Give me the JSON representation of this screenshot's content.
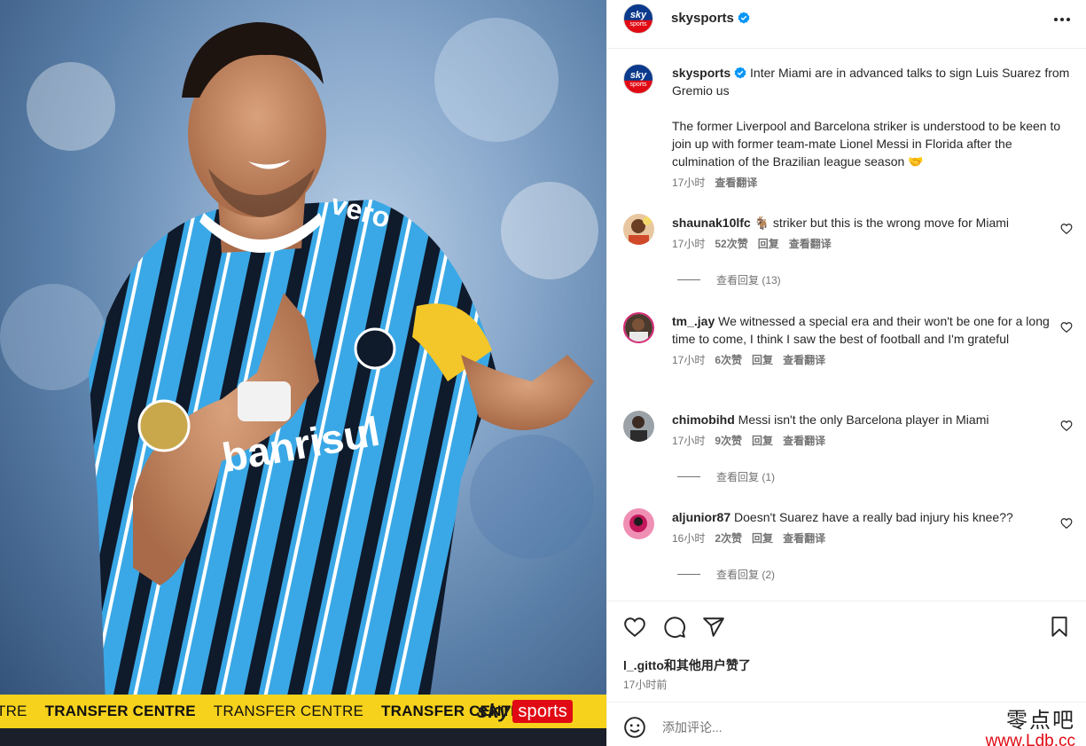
{
  "media": {
    "ticker": [
      "TRE",
      "TRANSFER CENTRE",
      "TRANSFER CENTRE",
      "TRANSFER CENTRE"
    ],
    "ticker_logo_sky": "sky",
    "ticker_logo_sports": "sports",
    "sponsor_text": "banrisul",
    "shirt_text": "vero"
  },
  "header": {
    "avatar_text": "sky",
    "avatar_sub": "sports",
    "username": "skysports"
  },
  "caption": {
    "username": "skysports",
    "line1": "Inter Miami are in advanced talks to sign Luis Suarez from Gremio us",
    "line2": "The former Liverpool and Barcelona striker is understood to be keen to join up with former team-mate Lionel Messi in Florida after the culmination of the Brazilian league season 🤝",
    "time": "17小时",
    "translate": "查看翻译"
  },
  "comments": [
    {
      "username": "shaunak10lfc",
      "text": "🐐 striker but this is the wrong move for Miami",
      "time": "17小时",
      "likes": "52次赞",
      "reply": "回复",
      "translate": "查看翻译",
      "view_replies": "查看回复 (13)"
    },
    {
      "username": "tm_.jay",
      "text": "We witnessed a special era and their won't be one for a long time to come, I think I saw the best of football and I'm grateful",
      "time": "17小时",
      "likes": "6次赞",
      "reply": "回复",
      "translate": "查看翻译",
      "view_replies": ""
    },
    {
      "username": "chimobihd",
      "text": "Messi isn't the only Barcelona player in Miami",
      "time": "17小时",
      "likes": "9次赞",
      "reply": "回复",
      "translate": "查看翻译",
      "view_replies": "查看回复 (1)"
    },
    {
      "username": "aljunior87",
      "text": "Doesn't Suarez have a really bad injury his knee??",
      "time": "16小时",
      "likes": "2次赞",
      "reply": "回复",
      "translate": "查看翻译",
      "view_replies": "查看回复 (2)"
    }
  ],
  "actions": {
    "likes_text": "l_.gitto和其他用户赞了",
    "time_ago": "17小时前"
  },
  "add_comment": {
    "placeholder": "添加评论..."
  },
  "watermark": {
    "cn": "零点吧",
    "url": "www.Ldb.cc"
  },
  "colors": {
    "accent_blue": "#0095f6",
    "ticker_yellow": "#f6d21c",
    "sky_red": "#e10a14",
    "sky_blue": "#0b3a8c",
    "muted_text": "#737373"
  }
}
